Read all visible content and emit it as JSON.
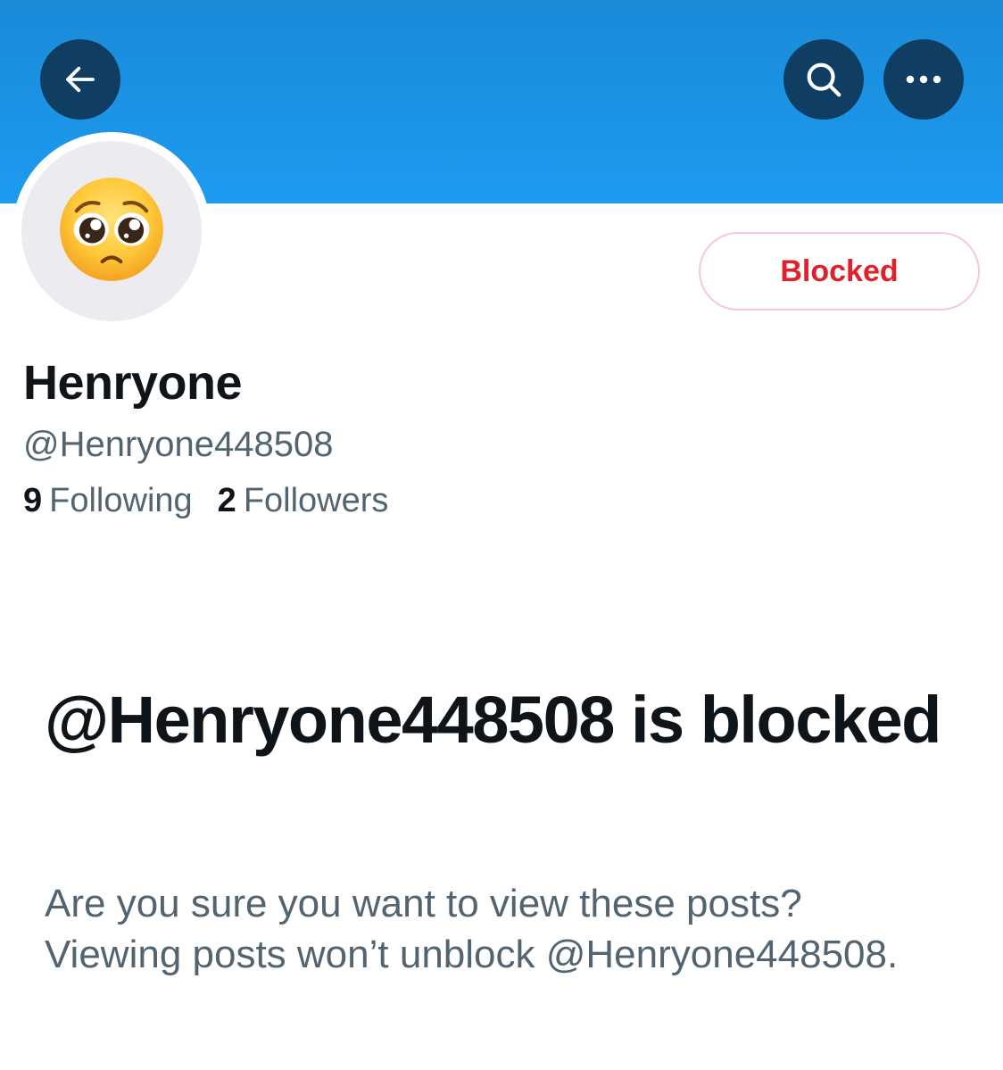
{
  "header": {
    "back_icon": "arrow-left-icon",
    "search_icon": "search-icon",
    "more_icon": "more-horizontal-icon",
    "banner_color": "#1d9bf0",
    "button_color": "#0f3e62"
  },
  "profile": {
    "avatar_emoji": "🥺",
    "display_name": "Henryone",
    "handle": "@Henryone448508",
    "following_count": "9",
    "following_label": "Following",
    "followers_count": "2",
    "followers_label": "Followers",
    "blocked_button_label": "Blocked",
    "blocked_color": "#e0212b"
  },
  "blocked_notice": {
    "title": "@Henryone448508 is blocked",
    "description": "Are you sure you want to view these posts? Viewing posts won’t unblock @Henryone448508."
  }
}
